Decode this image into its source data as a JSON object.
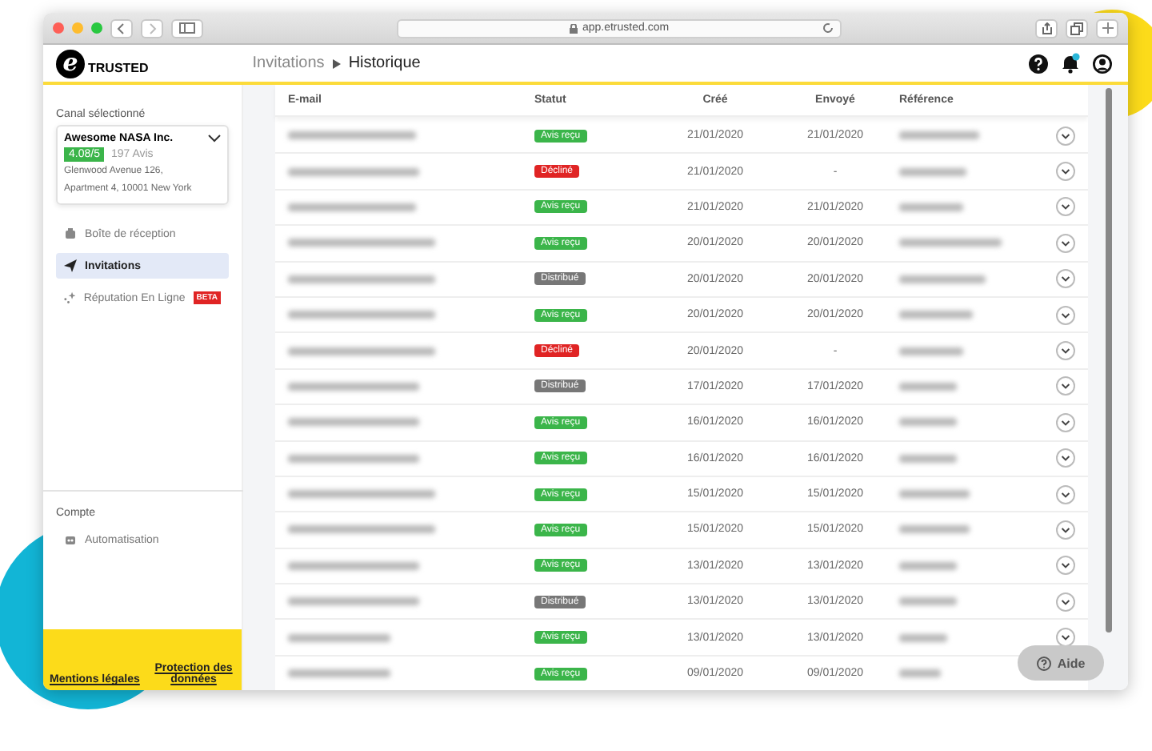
{
  "browser": {
    "url": "app.etrusted.com"
  },
  "logo": {
    "mark": "e",
    "name": "TRUSTED"
  },
  "breadcrumb": {
    "parent": "Invitations",
    "current": "Historique"
  },
  "notifications": {
    "unread": true
  },
  "sidebar": {
    "channel_label": "Canal sélectionné",
    "channel": {
      "name": "Awesome NASA Inc.",
      "rating": "4.08/5",
      "reviews": "197 Avis",
      "address_1": "Glenwood Avenue 126,",
      "address_2": "Apartment 4, 10001 New York"
    },
    "items": [
      {
        "kind": "inbox",
        "label": "Boîte de réception",
        "selected": false
      },
      {
        "kind": "invite",
        "label": "Invitations",
        "selected": true
      },
      {
        "kind": "reputation",
        "label": "Réputation En Ligne",
        "badge": "BETA",
        "selected": false
      }
    ],
    "account_label": "Compte",
    "account_items": [
      {
        "kind": "automation",
        "label": "Automatisation",
        "selected": false
      }
    ],
    "footer_links": [
      "Mentions légales",
      "Protection des données"
    ]
  },
  "table": {
    "columns": [
      "E-mail",
      "Statut",
      "Créé",
      "Envoyé",
      "Référence"
    ],
    "rows": [
      {
        "status": "Avis reçu",
        "kind": "received",
        "created": "21/01/2020",
        "sent": "21/01/2020"
      },
      {
        "status": "Décliné",
        "kind": "declined",
        "created": "21/01/2020",
        "sent": "-"
      },
      {
        "status": "Avis reçu",
        "kind": "received",
        "created": "21/01/2020",
        "sent": "21/01/2020"
      },
      {
        "status": "Avis reçu",
        "kind": "received",
        "created": "20/01/2020",
        "sent": "20/01/2020"
      },
      {
        "status": "Distribué",
        "kind": "delivered",
        "created": "20/01/2020",
        "sent": "20/01/2020"
      },
      {
        "status": "Avis reçu",
        "kind": "received",
        "created": "20/01/2020",
        "sent": "20/01/2020"
      },
      {
        "status": "Décliné",
        "kind": "declined",
        "created": "20/01/2020",
        "sent": "-"
      },
      {
        "status": "Distribué",
        "kind": "delivered",
        "created": "17/01/2020",
        "sent": "17/01/2020"
      },
      {
        "status": "Avis reçu",
        "kind": "received",
        "created": "16/01/2020",
        "sent": "16/01/2020"
      },
      {
        "status": "Avis reçu",
        "kind": "received",
        "created": "16/01/2020",
        "sent": "16/01/2020"
      },
      {
        "status": "Avis reçu",
        "kind": "received",
        "created": "15/01/2020",
        "sent": "15/01/2020"
      },
      {
        "status": "Avis reçu",
        "kind": "received",
        "created": "15/01/2020",
        "sent": "15/01/2020"
      },
      {
        "status": "Avis reçu",
        "kind": "received",
        "created": "13/01/2020",
        "sent": "13/01/2020"
      },
      {
        "status": "Distribué",
        "kind": "delivered",
        "created": "13/01/2020",
        "sent": "13/01/2020"
      },
      {
        "status": "Avis reçu",
        "kind": "received",
        "created": "13/01/2020",
        "sent": "13/01/2020"
      },
      {
        "status": "Avis reçu",
        "kind": "received",
        "created": "09/01/2020",
        "sent": "09/01/2020"
      }
    ]
  },
  "help_button": "Aide"
}
